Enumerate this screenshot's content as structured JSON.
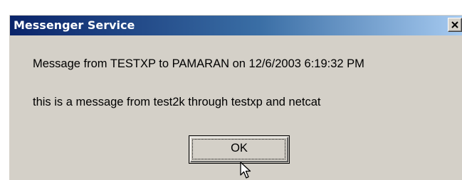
{
  "window": {
    "title": "Messenger Service",
    "close_icon": "close-x-icon"
  },
  "message": {
    "header_line": "Message from TESTXP to PAMARAN on 12/6/2003 6:19:32 PM",
    "body_line": "this is a message from test2k through testxp and netcat"
  },
  "buttons": {
    "ok_label": "OK"
  },
  "colors": {
    "title_gradient_start": "#0a246a",
    "title_gradient_end": "#a6caf0",
    "window_face": "#d4d0c8"
  },
  "pointer": "arrow-cursor-icon"
}
